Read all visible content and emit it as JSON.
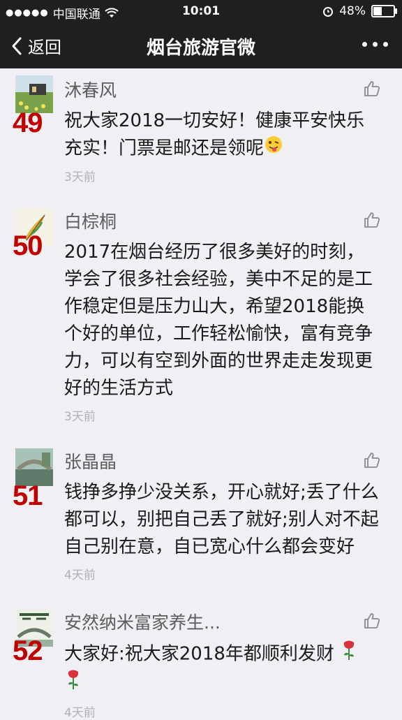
{
  "status_bar": {
    "signal_dots": "●●●●●",
    "carrier": "中国联通",
    "time": "10:01",
    "battery_percent": "48%",
    "battery_level": 0.48
  },
  "nav": {
    "back_label": "返回",
    "title": "烟台旅游官微"
  },
  "comments": [
    {
      "rank": "49",
      "name": "沐春风",
      "text": "祝大家2018一切安好！健康平安快乐充实！门票是邮还是领呢",
      "emoji": "winking-tongue-emoji",
      "time": "3天前"
    },
    {
      "rank": "50",
      "name": "白棕桐",
      "text": "2017在烟台经历了很多美好的时刻，学会了很多社会经验，美中不足的是工作稳定但是压力山大，希望2018能换个好的单位，工作轻松愉快，富有竞争力，可以有空到外面的世界走走发现更好的生活方式",
      "time": "3天前"
    },
    {
      "rank": "51",
      "name": "张晶晶",
      "text": "钱挣多挣少没关系，开心就好;丢了什么都可以，别把自己丢了就好;别人对不起自己别在意，自已宽心什么都会变好",
      "time": "4天前"
    },
    {
      "rank": "52",
      "name": "安然纳米富家养生...",
      "text": "大家好:祝大家2018年都顺利发财",
      "emoji": "rose-emoji",
      "time": "4天前"
    }
  ],
  "colors": {
    "bar_bg": "#1f1f21",
    "page_bg": "#efeff4",
    "rank_red": "#c00000",
    "name_gray": "#5c5c5c",
    "time_gray": "#b2b2b2"
  }
}
